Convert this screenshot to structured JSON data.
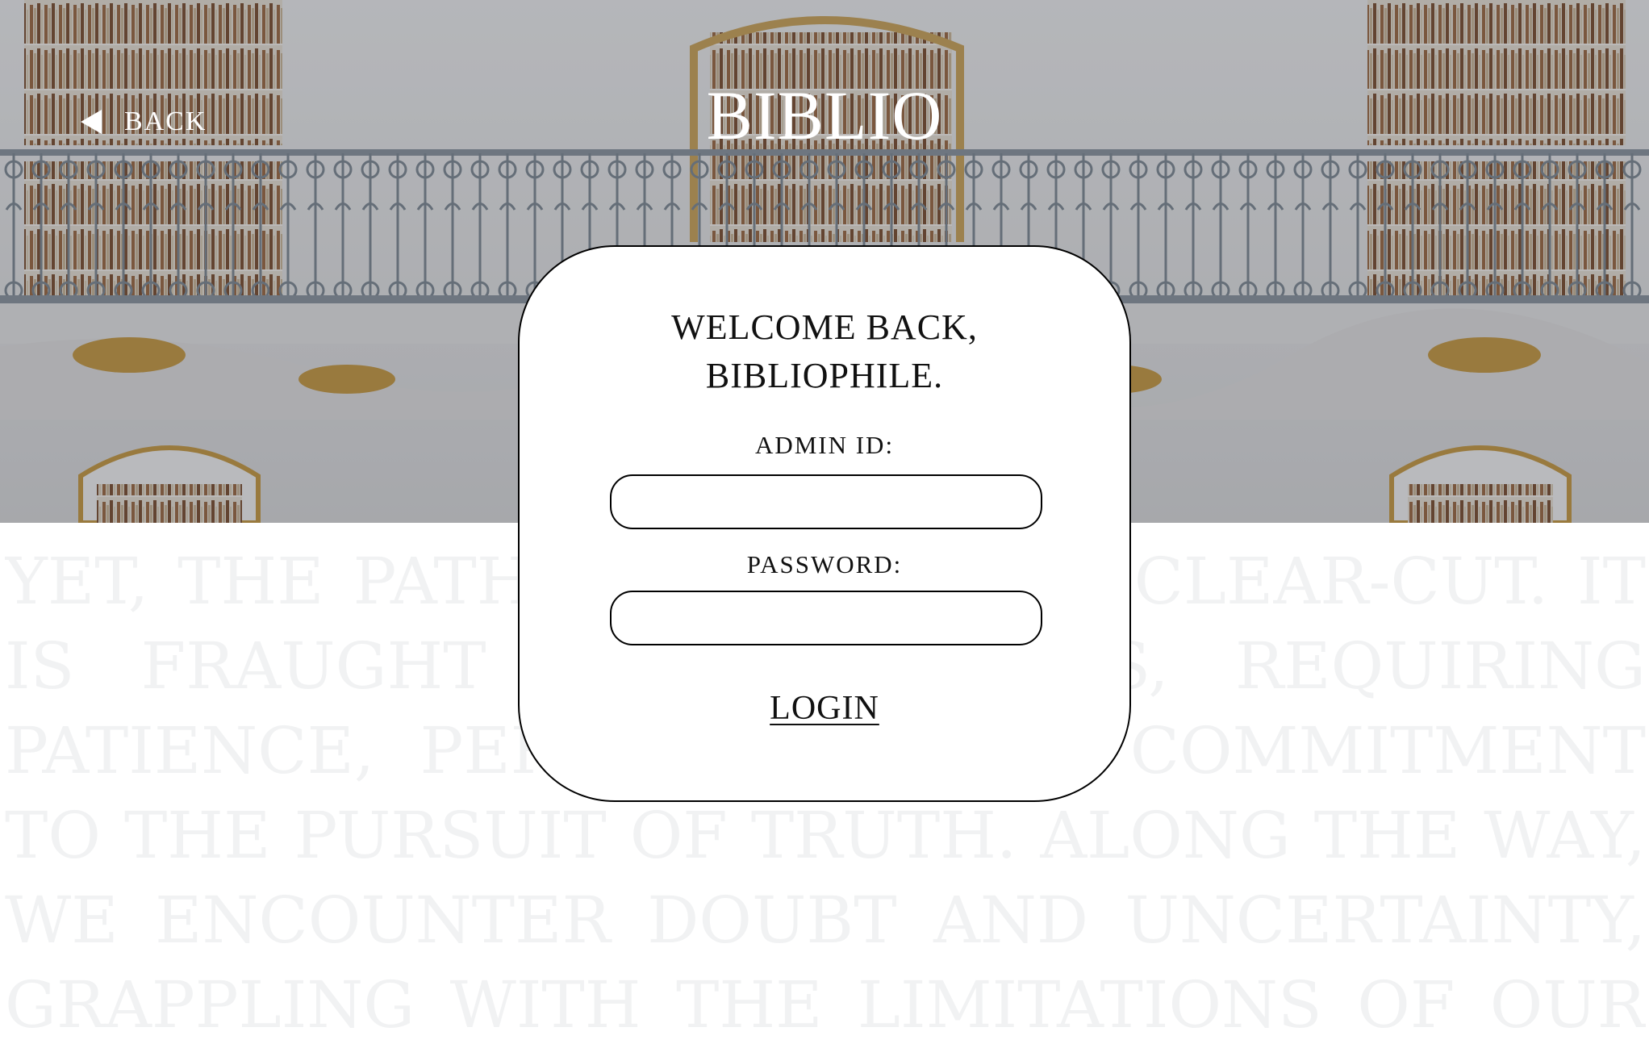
{
  "header": {
    "back_label": "BACK",
    "logo_text": "BIBLIO"
  },
  "background_text": "Yet, the path to e… always clear-cut. It is fraught wit… llenges, requiring patience, persever… ring commitment to the pursuit of truth. Along the way, we encounter doubt and uncertainty, grappling with the limitations of our own understanding. But it is through these",
  "card": {
    "title_line1": "WELCOME BACK,",
    "title_line2": "BIBLIOPHILE.",
    "admin_label": "ADMIN ID:",
    "admin_value": "",
    "password_label": "PASSWORD:",
    "password_value": "",
    "login_label": "LOGIN"
  },
  "colors": {
    "card_border": "#000000",
    "text_dark": "#111111",
    "background_text": "#f1f2f3",
    "header_text": "#ffffff"
  },
  "icons": {
    "back": "triangle-left-icon"
  }
}
